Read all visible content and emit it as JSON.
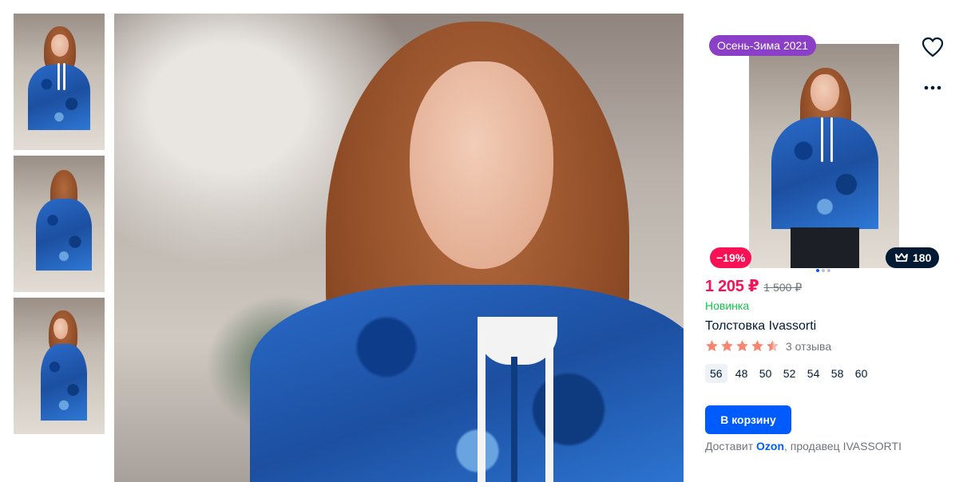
{
  "gallery": {
    "thumbnails": [
      {
        "alt": "photo-front"
      },
      {
        "alt": "photo-back"
      },
      {
        "alt": "photo-side"
      }
    ]
  },
  "product": {
    "season_badge": "Осень-Зима 2021",
    "discount_badge": "−19%",
    "points_badge": "180",
    "price_current": "1 205 ₽",
    "price_old": "1 500 ₽",
    "new_label": "Новинка",
    "title": "Толстовка Ivassorti",
    "rating": 4.5,
    "reviews_label": "3 отзыва",
    "sizes": [
      "56",
      "48",
      "50",
      "52",
      "54",
      "58",
      "60"
    ],
    "selected_size": "56",
    "cart_button": "В корзину",
    "delivery_prefix": "Доставит",
    "delivery_service": "Ozon",
    "delivery_suffix": ", продавец IVASSORTI",
    "photo_dots": 3,
    "active_dot": 0
  },
  "colors": {
    "price": "#f91155",
    "new": "#10c44c",
    "primary": "#005bff",
    "season_badge": "#8b3fc6",
    "points_badge": "#001a34",
    "star": "#f7856f"
  },
  "icons": {
    "favorite": "heart-icon",
    "more": "more-dots-icon",
    "points": "crown-icon",
    "rating": "star-icon"
  }
}
